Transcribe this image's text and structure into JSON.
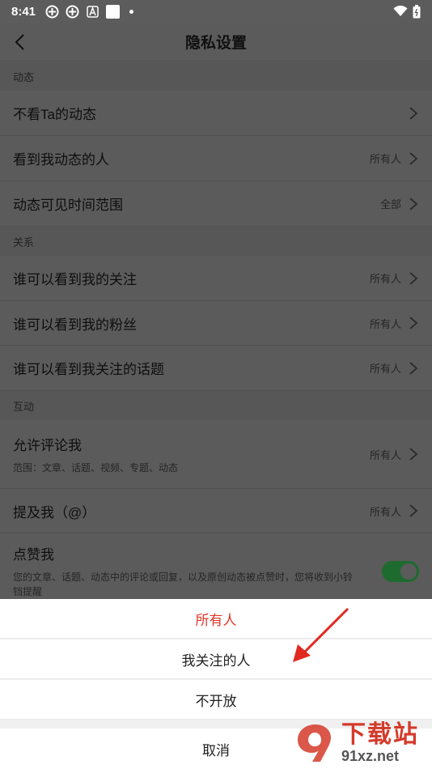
{
  "status": {
    "time": "8:41"
  },
  "header": {
    "title": "隐私设置"
  },
  "sections": {
    "dynamics": "动态",
    "relations": "关系",
    "interaction": "互动"
  },
  "rows": {
    "hide_ta": {
      "label": "不看Ta的动态"
    },
    "see_my_dynamics": {
      "label": "看到我动态的人",
      "value": "所有人"
    },
    "visible_time": {
      "label": "动态可见时间范围",
      "value": "全部"
    },
    "see_following": {
      "label": "谁可以看到我的关注",
      "value": "所有人"
    },
    "see_fans": {
      "label": "谁可以看到我的粉丝",
      "value": "所有人"
    },
    "see_topics": {
      "label": "谁可以看到我关注的话题",
      "value": "所有人"
    },
    "allow_comment": {
      "label": "允许评论我",
      "sub": "范围：文章、话题、视频、专题、动态",
      "value": "所有人"
    },
    "mention": {
      "label": "提及我（@）",
      "value": "所有人"
    },
    "like": {
      "label": "点赞我",
      "sub": "您的文章、话题、动态中的评论或回复，以及原创动态被点赞时，您将收到小铃铛提醒",
      "toggle_on": true
    }
  },
  "sheet": {
    "options": [
      "所有人",
      "我关注的人",
      "不开放"
    ],
    "selected": "所有人",
    "cancel": "取消"
  },
  "watermark": {
    "big": "下载站",
    "small": "91xz.net"
  },
  "colors": {
    "accent": "#e0382b",
    "toggle": "#1d6b2e"
  }
}
